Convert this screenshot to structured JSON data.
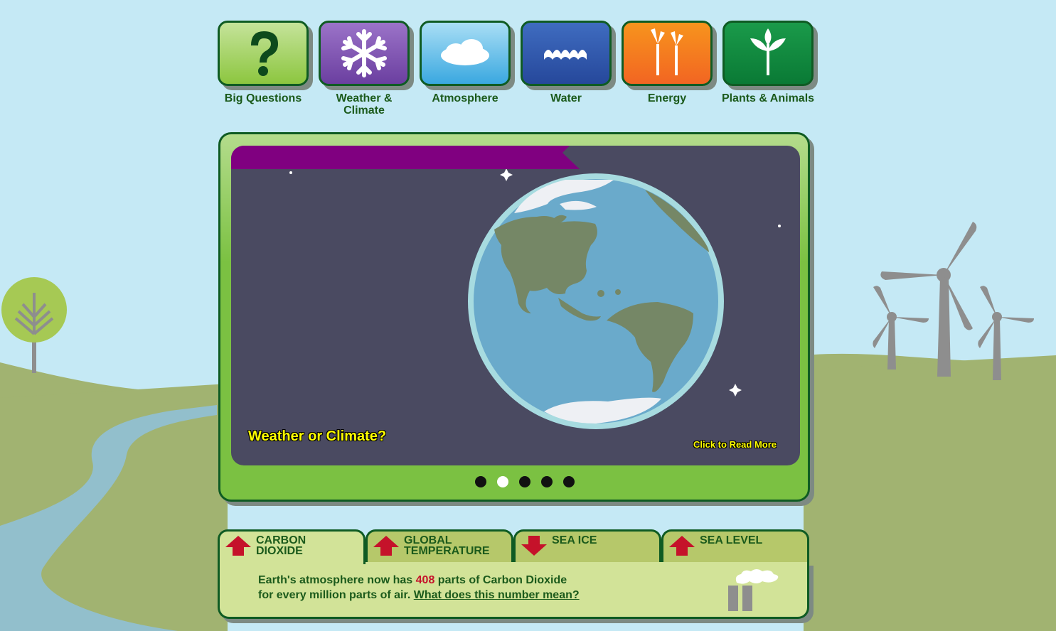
{
  "nav": {
    "items": [
      {
        "label": "Big Questions",
        "icon": "question-icon",
        "color": "#8cc63f"
      },
      {
        "label": "Weather & Climate",
        "icon": "snowflake-icon",
        "color": "#6b3fa0"
      },
      {
        "label": "Atmosphere",
        "icon": "cloud-icon",
        "color": "#3aa8e0"
      },
      {
        "label": "Water",
        "icon": "waves-icon",
        "color": "#26489b"
      },
      {
        "label": "Energy",
        "icon": "wind-turbine-icon",
        "color": "#f26522"
      },
      {
        "label": "Plants & Animals",
        "icon": "plant-sprout-icon",
        "color": "#0a7a35"
      }
    ]
  },
  "slideshow": {
    "caption": "Weather or Climate?",
    "read_more": "Click to Read More",
    "slide_count": 5,
    "active_index": 1
  },
  "vitals": {
    "tabs": [
      {
        "label_line1": "CARBON",
        "label_line2": "DIOXIDE",
        "trend": "up",
        "active": true
      },
      {
        "label_line1": "GLOBAL",
        "label_line2": "TEMPERATURE",
        "trend": "up",
        "active": false
      },
      {
        "label_line1": "SEA ICE",
        "label_line2": "",
        "trend": "down",
        "active": false
      },
      {
        "label_line1": "SEA LEVEL",
        "label_line2": "",
        "trend": "up",
        "active": false
      }
    ],
    "text_before": "Earth's atmosphere now has ",
    "value": "408",
    "text_after": " parts of Carbon Dioxide",
    "line2_text": "for every million parts of air. ",
    "link_text": "What does this number mean?"
  },
  "colors": {
    "sky": "#c5e9f5",
    "hills": "#a1b371",
    "river": "#92bfcc",
    "dark_green_border": "#0f5b23",
    "ribbon": "#800080",
    "caption_yellow": "#ffff00",
    "trend_red": "#c5122a"
  }
}
